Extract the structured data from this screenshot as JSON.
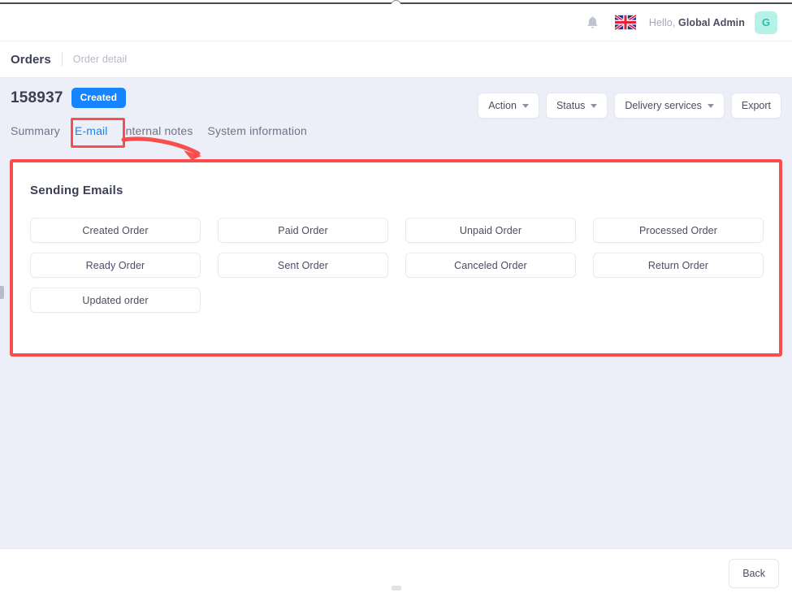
{
  "header": {
    "bell_icon": "bell-icon",
    "flag_icon": "uk-flag-icon",
    "greeting_prefix": "Hello,",
    "user_name": "Global Admin",
    "avatar_initial": "G"
  },
  "breadcrumb": {
    "main": "Orders",
    "current": "Order detail"
  },
  "order": {
    "number": "158937",
    "status_badge": "Created"
  },
  "toolbar": {
    "buttons": [
      {
        "label": "Action",
        "has_caret": true
      },
      {
        "label": "Status",
        "has_caret": true
      },
      {
        "label": "Delivery services",
        "has_caret": true
      },
      {
        "label": "Export",
        "has_caret": false
      }
    ]
  },
  "tabs": [
    {
      "label": "Summary",
      "active": false
    },
    {
      "label": "E-mail",
      "active": true
    },
    {
      "label": "Internal notes",
      "active": false
    },
    {
      "label": "System information",
      "active": false
    }
  ],
  "panel": {
    "title": "Sending Emails",
    "email_buttons": [
      "Created Order",
      "Paid Order",
      "Unpaid Order",
      "Processed Order",
      "Ready Order",
      "Sent Order",
      "Canceled Order",
      "Return Order",
      "Updated order"
    ]
  },
  "footer": {
    "back_label": "Back"
  },
  "colors": {
    "accent_blue": "#1684fc",
    "annotation_red": "#fa4d4d",
    "page_background": "#eceff7",
    "avatar_background": "#b6f2e8",
    "avatar_text": "#2bbcae",
    "text_primary": "#3c3f55",
    "text_muted": "#a3a6b4"
  }
}
